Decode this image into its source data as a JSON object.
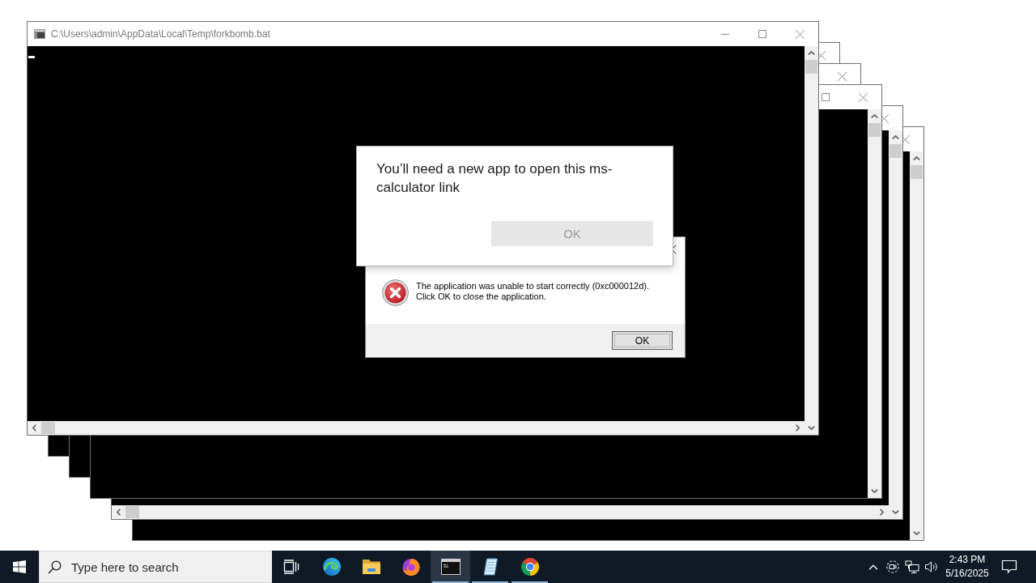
{
  "desktop": {
    "console_window": {
      "title": "C:\\Users\\admin\\AppData\\Local\\Temp\\forkbomb.bat",
      "title_buttons": [
        {
          "kind": "minimize"
        },
        {
          "kind": "maximize"
        },
        {
          "kind": "close"
        }
      ],
      "cursor": true,
      "horizontal_scrollbar": true
    },
    "background_windows": [
      {
        "title_buttons": [
          {
            "kind": "close"
          }
        ],
        "horizontal_scrollbar": false
      },
      {
        "title_buttons": [
          {
            "kind": "close"
          }
        ],
        "horizontal_scrollbar": false
      },
      {
        "title_buttons": [
          {
            "kind": "maximize"
          },
          {
            "kind": "close"
          }
        ],
        "horizontal_scrollbar": false
      },
      {
        "title_buttons": [
          {
            "kind": "close"
          }
        ],
        "horizontal_scrollbar": true
      },
      {
        "title_buttons": [
          {
            "kind": "close"
          }
        ],
        "horizontal_scrollbar": false
      }
    ],
    "error_dialog": {
      "message": "The application was unable to start correctly (0xc000012d).\nClick OK to close the application.",
      "button": "OK"
    },
    "app_prompt": {
      "message": "You’ll need a new app to open this ms-calculator link",
      "button": {
        "label": "OK",
        "disabled": true
      }
    }
  },
  "taskbar": {
    "search": {
      "placeholder": "Type here to search"
    },
    "apps": [
      {
        "kind": "swirl",
        "running": false,
        "selected": false
      },
      {
        "kind": "folder",
        "running": false,
        "selected": false
      },
      {
        "kind": "fox",
        "running": false,
        "selected": false
      },
      {
        "kind": "terminal",
        "running": true,
        "selected": true
      },
      {
        "kind": "notepad",
        "running": true,
        "selected": false
      },
      {
        "kind": "wheel",
        "running": true,
        "selected": false
      }
    ],
    "clock": {
      "time": "2:43 PM",
      "date": "5/16/2025"
    }
  }
}
